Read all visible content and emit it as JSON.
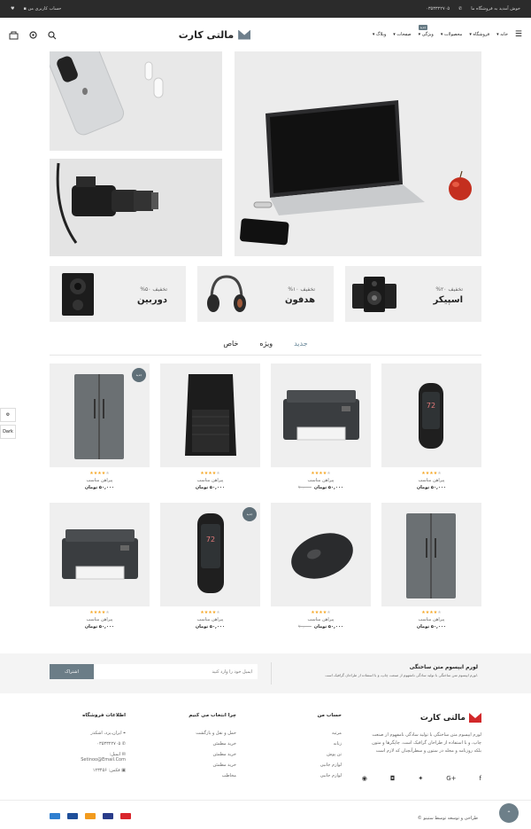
{
  "topbar": {
    "welcome": "خوش آمدید به فروشگاه ما",
    "phone": "۰۳۵۳۳۲۲۷۰۵",
    "account": "حساب کاربری من"
  },
  "header": {
    "logo": "مالتی کارت",
    "nav": [
      "خانه",
      "فروشگاه",
      "محصولات",
      "ویژگی",
      "صفحات",
      "وبلاگ"
    ],
    "nav_badge": "جدید"
  },
  "promos": [
    {
      "pct": "%۵۰ تخفیف",
      "name": "دوربین"
    },
    {
      "pct": "%۱۰ تخفیف",
      "name": "هدفون"
    },
    {
      "pct": "%۲۰ تخفیف",
      "name": "اسپیکر"
    }
  ],
  "tabs": [
    "جدید",
    "ویژه",
    "خاص"
  ],
  "product_badge": "جدید",
  "products": [
    {
      "title": "پیراهن مناسب",
      "price": "۵۰,۰۰۰ تومان",
      "old": "",
      "stars": 4
    },
    {
      "title": "پیراهن مناسب",
      "price": "۵۰,۰۰۰ تومان",
      "old": "۷۰,۰۰۰",
      "stars": 4
    },
    {
      "title": "پیراهن مناسب",
      "price": "۵۰,۰۰۰ تومان",
      "old": "",
      "stars": 4
    },
    {
      "title": "پیراهن مناسب",
      "price": "۵۰,۰۰۰ تومان",
      "old": "",
      "stars": 4
    },
    {
      "title": "پیراهن مناسب",
      "price": "۵۰,۰۰۰ تومان",
      "old": "",
      "stars": 4
    },
    {
      "title": "پیراهن مناسب",
      "price": "۵۰,۰۰۰ تومان",
      "old": "۷۰,۰۰۰",
      "stars": 4
    },
    {
      "title": "پیراهن مناسب",
      "price": "۵۰,۰۰۰ تومان",
      "old": "",
      "stars": 4
    },
    {
      "title": "پیراهن مناسب",
      "price": "۵۰,۰۰۰ تومان",
      "old": "",
      "stars": 4
    }
  ],
  "newsletter": {
    "title": "لورم ایپسوم متن ساختگی",
    "desc": "لورم ایپسوم متن ساختگی با تولید سادگی نامفهوم از صنعت چاپ، و با استفاده از طراحان گرافیک است.",
    "placeholder": "ایمیل خود را وارد کنید",
    "button": "اشتراک"
  },
  "footer": {
    "about_title": "مالتی کارت",
    "about_text": "لورم ایپسوم متن ساختگی با تولید سادگی نامفهوم از صنعت چاپ، و با استفاده از طراحان گرافیک است. چاپگرها و متون بلکه روزنامه و مجله در ستون و سطرآنچنان که لازم است",
    "account_title": "حساب من",
    "account_links": [
      "مرتبه",
      "زنانه",
      "تن پوش",
      "لوازم جانبی",
      "لوازم جانبی"
    ],
    "why_title": "چرا انتخاب می کنیم",
    "why_links": [
      "حمل و نقل و بازگشت",
      "خرید مطمئن",
      "خرید مطمئن",
      "خرید مطمئن",
      "مخاطب"
    ],
    "info_title": "اطلاعات فروشگاه",
    "info_address": "ایران،یزد، اشکذر",
    "info_phone": "۰۳۵۳۳۲۲۷۰۵",
    "info_email_label": "ایمیل:",
    "info_email": "Setinoo@Email.Com",
    "info_fax": "فکس: ۱۲۳۴۵۶"
  },
  "copyright": "© طراحی و توسعه توسط ستینو",
  "sidepanel": {
    "dark": "Dark"
  },
  "colors": {
    "accent": "#6c8a9b",
    "dark": "#2b2b2b",
    "star": "#f5a623"
  }
}
